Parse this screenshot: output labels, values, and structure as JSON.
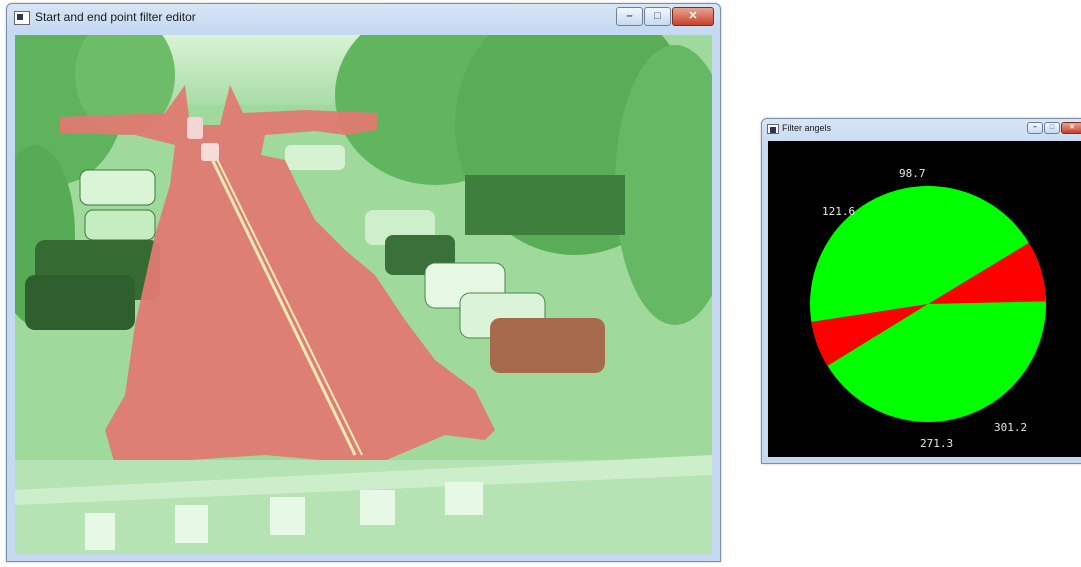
{
  "main_window": {
    "title": "Start and end point filter editor",
    "controls": {
      "minimize": "–",
      "maximize": "□",
      "close": "✕"
    },
    "regions": {
      "overlay_allowed": "#6fe06f",
      "overlay_blocked": "#e06a6a"
    }
  },
  "angles_window": {
    "title": "Filter angels",
    "controls": {
      "minimize": "–",
      "maximize": "□",
      "close": "✕"
    },
    "chart_data": {
      "type": "pie",
      "title": "",
      "slices": [
        {
          "label_from": "98.7",
          "label_to": "121.6",
          "start": 98.7,
          "end": 121.6,
          "color": "#ff0000"
        },
        {
          "label_from": "271.3",
          "label_to": "301.2",
          "start": 271.3,
          "end": 301.2,
          "color": "#ff0000"
        }
      ],
      "background_color": "#00ff00",
      "labels": [
        "98.7",
        "121.6",
        "271.3",
        "301.2"
      ]
    }
  }
}
